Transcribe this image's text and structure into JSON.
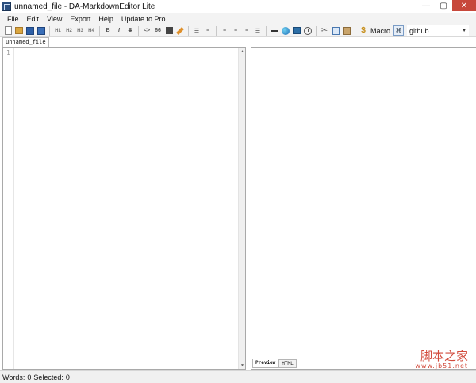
{
  "window": {
    "title": "unnamed_file - DA-MarkdownEditor Lite",
    "controls": {
      "minimize": "—",
      "maximize": "▢",
      "close": "✕"
    }
  },
  "menu": {
    "items": [
      "File",
      "Edit",
      "View",
      "Export",
      "Help",
      "Update to Pro"
    ]
  },
  "toolbar": {
    "h1": "H1",
    "h2": "H2",
    "h3": "H3",
    "h4": "H4",
    "bold": "B",
    "italic": "I",
    "strike": "S",
    "code": "<>",
    "quote": "66",
    "macro_label": "Macro",
    "theme_value": "github",
    "icons": [
      "new-file-icon",
      "open-folder-icon",
      "save-icon",
      "save-all-icon",
      "table-icon",
      "pencil-icon",
      "unordered-list-icon",
      "ordered-list-icon",
      "align-left-icon",
      "align-center-icon",
      "align-right-icon",
      "justify-icon",
      "horizontal-rule-icon",
      "image-icon",
      "link-icon",
      "clock-icon",
      "cut-icon",
      "copy-icon",
      "paste-icon",
      "dollar-macro-icon",
      "theme-icon"
    ]
  },
  "document": {
    "tab_name": "unnamed_file",
    "line_numbers": [
      "1"
    ]
  },
  "preview": {
    "tabs": [
      "Preview",
      "HTML"
    ]
  },
  "status": {
    "words_label": "Words:",
    "words_value": "0",
    "selected_label": "Selected:",
    "selected_value": "0"
  },
  "watermark": {
    "logo_text": "脚本之家",
    "url": "www.jb51.net"
  }
}
